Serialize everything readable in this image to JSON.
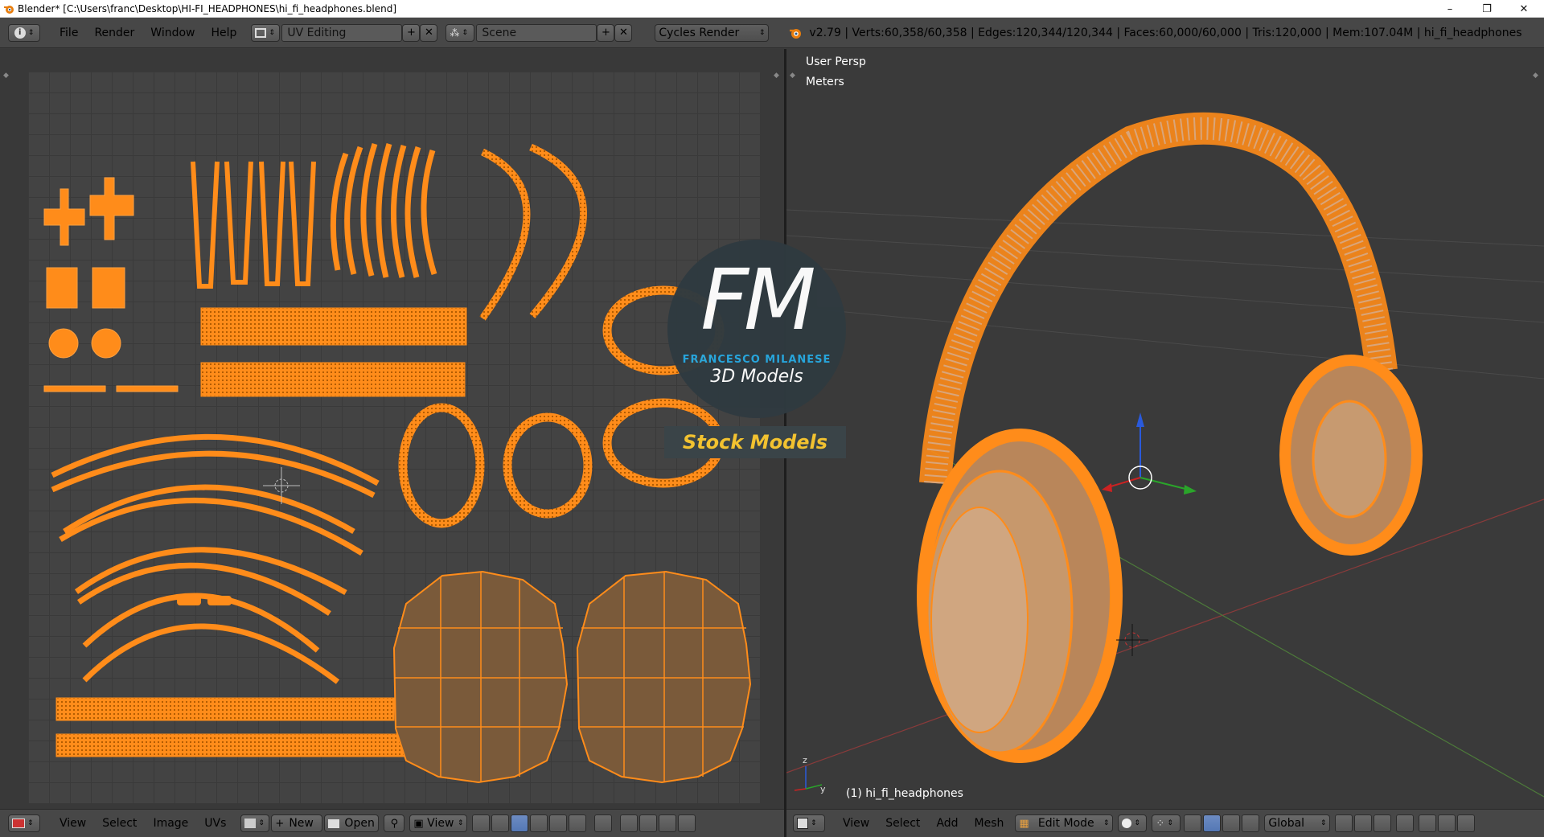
{
  "window": {
    "title": "Blender* [C:\\Users\\franc\\Desktop\\HI-FI_HEADPHONES\\hi_fi_headphones.blend]",
    "minimize": "–",
    "restore": "❐",
    "close": "✕"
  },
  "info_header": {
    "menus": [
      "File",
      "Render",
      "Window",
      "Help"
    ],
    "layout": "UV Editing",
    "scene": "Scene",
    "render_engine": "Cycles Render",
    "stats": "v2.79 | Verts:60,358/60,358 | Edges:120,344/120,344 | Faces:60,000/60,000 | Tris:120,000 | Mem:107.04M | hi_fi_headphones"
  },
  "viewport": {
    "view_name": "User Persp",
    "units": "Meters",
    "object_label": "(1) hi_fi_headphones",
    "axis_x": "x",
    "axis_y": "y",
    "axis_z": "z"
  },
  "watermark": {
    "logo_letters": "FM",
    "brand": "FRANCESCO MILANESE",
    "subtitle": "3D Models",
    "banner": "Stock Models"
  },
  "uv_header": {
    "menus": [
      "View",
      "Select",
      "Image",
      "UVs"
    ],
    "new_label": "New",
    "open_label": "Open",
    "view_label": "View"
  },
  "view3d_header": {
    "menus": [
      "View",
      "Select",
      "Add",
      "Mesh"
    ],
    "mode": "Edit Mode",
    "orientation": "Global"
  },
  "colors": {
    "accent_orange": "#ff8c1a",
    "uv_fill": "#7a5a3a",
    "panel": "#474747",
    "grid": "#434343"
  }
}
